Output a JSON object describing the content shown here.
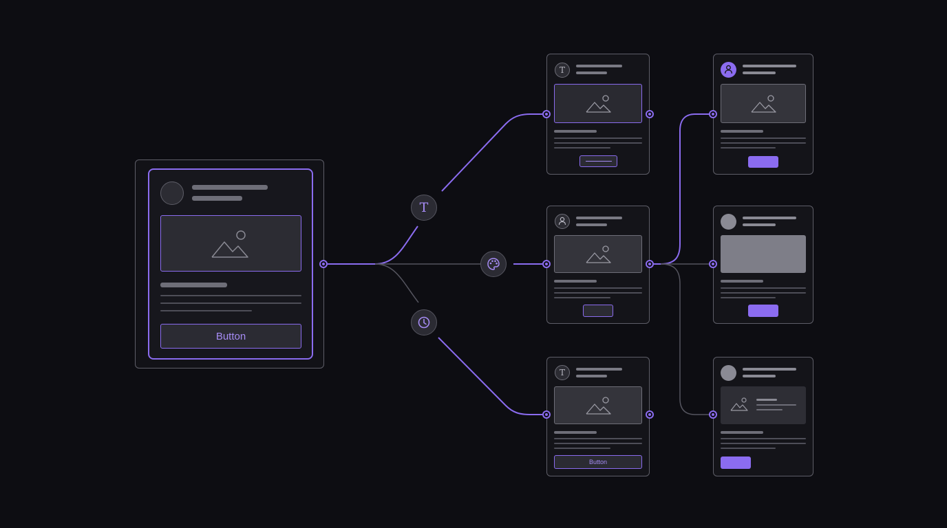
{
  "source_card": {
    "button_label": "Button"
  },
  "tools": {
    "typography_icon": "T",
    "color_icon": "palette-icon",
    "time_icon": "clock-icon"
  },
  "variants": {
    "text_top": {
      "avatar_glyph": "T"
    },
    "text_bottom": {
      "avatar_glyph": "T",
      "button_label": "Button"
    }
  },
  "colors": {
    "accent": "#8b6cf0",
    "background": "#0d0d12",
    "frame_border": "#5e5e68",
    "connector_neutral": "#55555f"
  }
}
